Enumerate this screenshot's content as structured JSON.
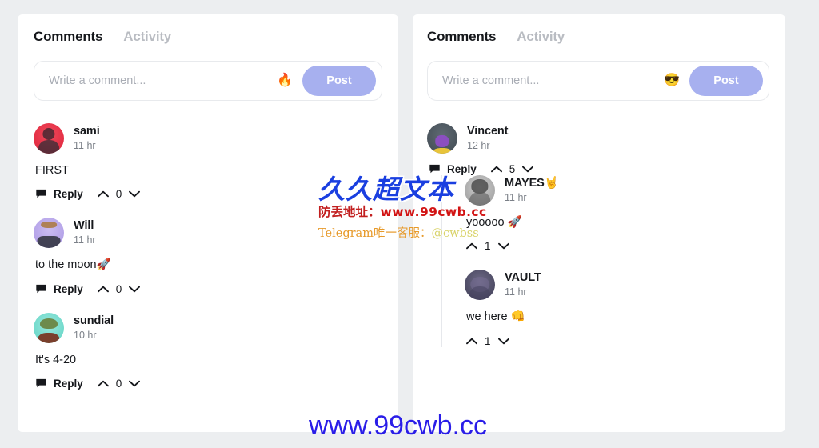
{
  "panels": [
    {
      "id": "left",
      "tabs": [
        {
          "label": "Comments",
          "active": true
        },
        {
          "label": "Activity",
          "active": false
        }
      ],
      "composer": {
        "placeholder": "Write a comment...",
        "value": "",
        "emoji": "🔥",
        "emoji_name": "fire-emoji",
        "post_label": "Post"
      },
      "comments": [
        {
          "author": "sami",
          "timestamp": "11 hr",
          "text": "FIRST",
          "reply_label": "Reply",
          "votes": "0",
          "avatar_class": "av-sami",
          "avatar_name": "avatar-sami"
        },
        {
          "author": "Will",
          "timestamp": "11 hr",
          "text": "to the moon🚀",
          "reply_label": "Reply",
          "votes": "0",
          "avatar_class": "av-will",
          "avatar_name": "avatar-will"
        },
        {
          "author": "sundial",
          "timestamp": "10 hr",
          "text": "It's 4-20",
          "reply_label": "Reply",
          "votes": "0",
          "avatar_class": "av-sundial",
          "avatar_name": "avatar-sundial"
        }
      ]
    },
    {
      "id": "right",
      "tabs": [
        {
          "label": "Comments",
          "active": true
        },
        {
          "label": "Activity",
          "active": false
        }
      ],
      "composer": {
        "placeholder": "Write a comment...",
        "value": "",
        "emoji": "😎",
        "emoji_name": "sunglasses-emoji",
        "post_label": "Post"
      },
      "comments": [
        {
          "author": "Vincent",
          "timestamp": "12 hr",
          "text": "",
          "reply_label": "Reply",
          "votes": "5",
          "avatar_class": "av-vincent",
          "avatar_name": "avatar-vincent",
          "replies": [
            {
              "author": "MAYES🤘",
              "timestamp": "11 hr",
              "text": "yooooo 🚀",
              "votes": "1",
              "avatar_class": "av-mayes",
              "avatar_name": "avatar-mayes"
            },
            {
              "author": "VAULT",
              "timestamp": "11 hr",
              "text": "we here 👊",
              "votes": "1",
              "avatar_class": "av-vault",
              "avatar_name": "avatar-vault"
            }
          ]
        }
      ]
    }
  ],
  "watermark": {
    "main": "久久超文本",
    "address_label": "防丢地址：",
    "address_url": "www.99cwb.cc",
    "telegram_label": "Telegram唯一客服：",
    "telegram_handle": "@cwbss",
    "bottom_url": "www.99cwb.cc"
  }
}
